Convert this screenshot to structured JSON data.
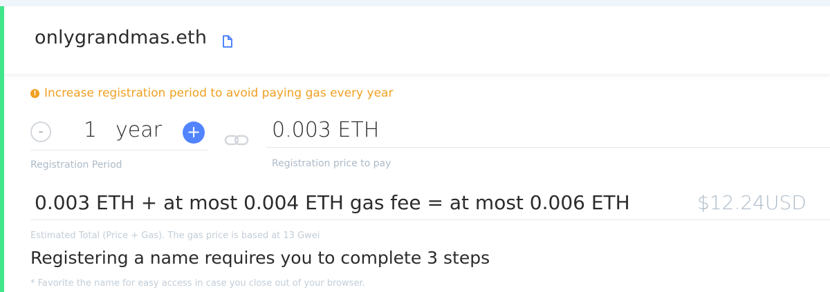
{
  "domain": {
    "name": "onlygrandmas.eth",
    "copy_icon": "document-icon"
  },
  "warning": {
    "icon": "alert-circle-icon",
    "text": "Increase registration period to avoid paying gas every year",
    "color": "#f0a020"
  },
  "period": {
    "decrement_label": "-",
    "value": "1",
    "unit": "year",
    "increment_label": "+",
    "label": "Registration Period"
  },
  "link_icon": "chain-link-icon",
  "price": {
    "value": "0.003 ETH",
    "label": "Registration price to pay"
  },
  "total": {
    "expression": "0.003 ETH + at most 0.004 ETH gas fee = at most 0.006 ETH",
    "usd": "$12.24USD",
    "label": "Estimated Total (Price + Gas). The gas price is based at 13 Gwei"
  },
  "steps_heading": "Registering a name requires you to complete 3 steps",
  "favorite_note": "* Favorite the name for easy access in case you close out of your browser.",
  "colors": {
    "accent_blue": "#5284ff",
    "status_green": "#42e68a",
    "muted_text": "#adbbc8"
  }
}
